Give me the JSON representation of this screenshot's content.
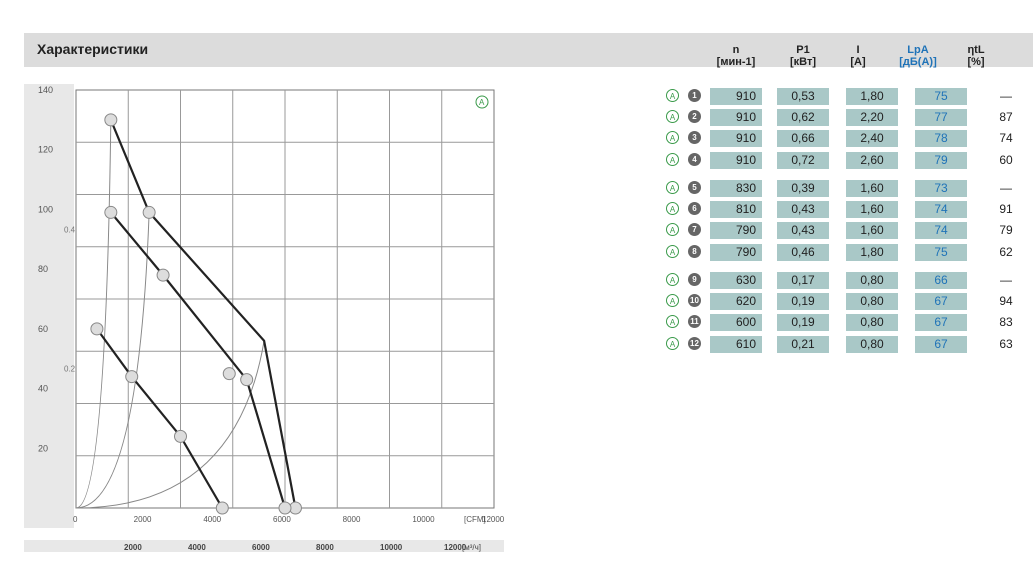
{
  "header": {
    "title": "Характеристики",
    "columns": [
      {
        "name": "n",
        "unit": "[мин-1]"
      },
      {
        "name": "P1",
        "unit": "[кВт]"
      },
      {
        "name": "I",
        "unit": "[A]"
      },
      {
        "name": "LpA",
        "unit": "[дБ(A)]"
      },
      {
        "name": "ηtL",
        "unit": "[%]"
      }
    ]
  },
  "colors": {
    "header_bg": "#dcdcdc",
    "cell_bg": "#a9c8c7",
    "accent_blue": "#1f73b8",
    "marker_green": "#3a9a4a"
  },
  "table": {
    "rows": [
      {
        "letter": "A",
        "id": "1",
        "n": "910",
        "p": "0,53",
        "i": "1,80",
        "lp": "75",
        "eta": "—"
      },
      {
        "letter": "A",
        "id": "2",
        "n": "910",
        "p": "0,62",
        "i": "2,20",
        "lp": "77",
        "eta": "87"
      },
      {
        "letter": "A",
        "id": "3",
        "n": "910",
        "p": "0,66",
        "i": "2,40",
        "lp": "78",
        "eta": "74"
      },
      {
        "letter": "A",
        "id": "4",
        "n": "910",
        "p": "0,72",
        "i": "2,60",
        "lp": "79",
        "eta": "60"
      },
      {
        "letter": "A",
        "id": "5",
        "n": "830",
        "p": "0,39",
        "i": "1,60",
        "lp": "73",
        "eta": "—"
      },
      {
        "letter": "A",
        "id": "6",
        "n": "810",
        "p": "0,43",
        "i": "1,60",
        "lp": "74",
        "eta": "91"
      },
      {
        "letter": "A",
        "id": "7",
        "n": "790",
        "p": "0,43",
        "i": "1,60",
        "lp": "74",
        "eta": "79"
      },
      {
        "letter": "A",
        "id": "8",
        "n": "790",
        "p": "0,46",
        "i": "1,80",
        "lp": "75",
        "eta": "62"
      },
      {
        "letter": "A",
        "id": "9",
        "n": "630",
        "p": "0,17",
        "i": "0,80",
        "lp": "66",
        "eta": "—"
      },
      {
        "letter": "A",
        "id": "10",
        "n": "620",
        "p": "0,19",
        "i": "0,80",
        "lp": "67",
        "eta": "94"
      },
      {
        "letter": "A",
        "id": "11",
        "n": "600",
        "p": "0,19",
        "i": "0,80",
        "lp": "67",
        "eta": "83"
      },
      {
        "letter": "A",
        "id": "12",
        "n": "610",
        "p": "0,21",
        "i": "0,80",
        "lp": "67",
        "eta": "63"
      }
    ]
  },
  "chart_data": {
    "type": "line",
    "legend_marker": "A",
    "xlabel": "[CFM]",
    "xlabel_secondary": "[м³/ч]",
    "x_ticks": [
      0,
      2000,
      4000,
      6000,
      8000,
      10000,
      12000
    ],
    "x_ticks_secondary": [
      2000,
      4000,
      6000,
      8000,
      10000,
      12000
    ],
    "y_ticks": [
      20,
      40,
      60,
      80,
      100,
      120,
      140
    ],
    "y_ticks_secondary": [
      0.2,
      0.4
    ],
    "xlim": [
      0,
      12000
    ],
    "ylim": [
      0,
      140
    ],
    "series": [
      {
        "name": "910",
        "points": [
          [
            1000,
            130
          ],
          [
            2100,
            99
          ],
          [
            5400,
            56
          ],
          [
            6300,
            0
          ]
        ]
      },
      {
        "name": "810",
        "points": [
          [
            1000,
            99
          ],
          [
            2500,
            78
          ],
          [
            4900,
            43
          ],
          [
            6000,
            0
          ]
        ]
      },
      {
        "name": "630",
        "points": [
          [
            600,
            60
          ],
          [
            1600,
            44
          ],
          [
            3000,
            24
          ],
          [
            4200,
            0
          ]
        ]
      }
    ],
    "system_curves": [
      {
        "points": [
          [
            0,
            0
          ],
          [
            1000,
            130
          ]
        ]
      },
      {
        "points": [
          [
            0,
            0
          ],
          [
            2100,
            99
          ]
        ]
      },
      {
        "points": [
          [
            0,
            0
          ],
          [
            5400,
            56
          ]
        ]
      }
    ],
    "markers": [
      {
        "id": "1",
        "x": 1000,
        "y": 130
      },
      {
        "id": "2",
        "x": 2100,
        "y": 99
      },
      {
        "id": "3",
        "x": 4400,
        "y": 45
      },
      {
        "id": "4",
        "x": 6300,
        "y": 0
      },
      {
        "id": "5",
        "x": 1000,
        "y": 99
      },
      {
        "id": "6",
        "x": 2500,
        "y": 78
      },
      {
        "id": "7",
        "x": 4900,
        "y": 43
      },
      {
        "id": "8",
        "x": 6000,
        "y": 0
      },
      {
        "id": "9",
        "x": 600,
        "y": 60
      },
      {
        "id": "10",
        "x": 1600,
        "y": 44
      },
      {
        "id": "11",
        "x": 3000,
        "y": 24
      },
      {
        "id": "12",
        "x": 4200,
        "y": 0
      }
    ]
  }
}
